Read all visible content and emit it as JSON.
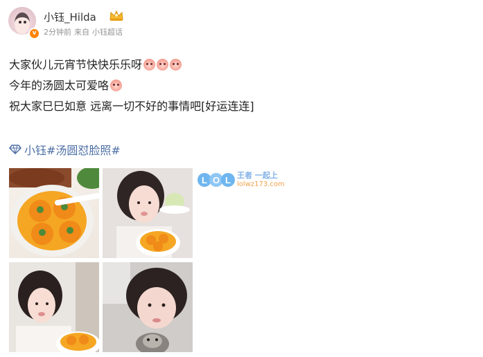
{
  "post": {
    "username": "小钰_Hilda",
    "verified_mark": "v",
    "meta": {
      "time": "2分钟前",
      "source_prefix": "来自",
      "source": "小钰超话"
    },
    "lines": [
      "大家伙儿元宵节快快乐乐呀",
      "今年的汤圆太可爱咯",
      "祝大家巳巳如意 远离一切不好的事情吧[好运连连]"
    ],
    "topic": "小钰#汤圆怼脸照#",
    "icons": {
      "crown": "crown-icon",
      "topic": "diamond-icon",
      "emoji": "blush-face-emoji"
    }
  },
  "watermark": {
    "logo_text": "LOL",
    "title": "王者 一起上",
    "url": "lolwz173.com"
  },
  "colors": {
    "username": "#333333",
    "meta": "#939393",
    "topic": "#4d6fa6",
    "badge": "#ff8200"
  }
}
